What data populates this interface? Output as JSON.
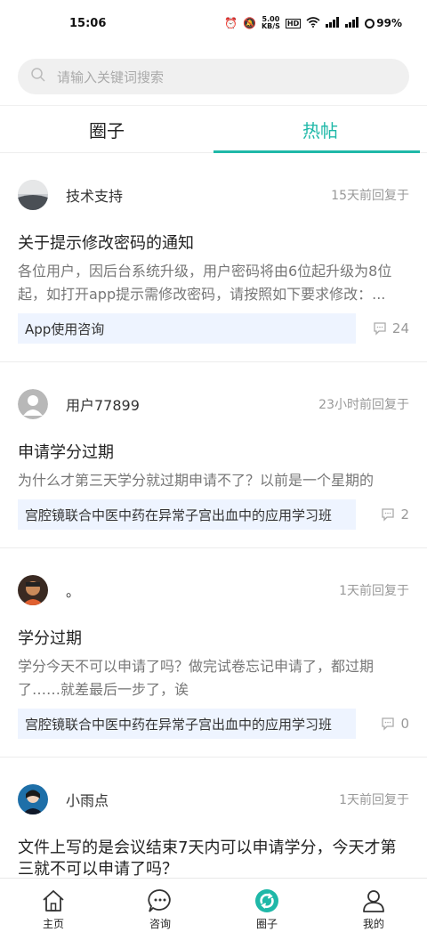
{
  "status_bar": {
    "time": "15:06",
    "net_speed": "5.00\nKB/S",
    "battery": "99%"
  },
  "search": {
    "placeholder": "请输入关键词搜索"
  },
  "tabs": [
    {
      "label": "圈子",
      "active": false
    },
    {
      "label": "热帖",
      "active": true
    }
  ],
  "posts": [
    {
      "author": "技术支持",
      "time": "15天前回复于",
      "title": "关于提示修改密码的通知",
      "body": "各位用户，因后台系统升级，用户密码将由6位起升级为8位起，如打开app提示需修改密码，请按照如下要求修改：...",
      "tag": "App使用咨询",
      "comments": "24"
    },
    {
      "author": "用户77899",
      "time": "23小时前回复于",
      "title": "申请学分过期",
      "body": "为什么才第三天学分就过期申请不了？以前是一个星期的",
      "tag": "宫腔镜联合中医中药在异常子宫出血中的应用学习班",
      "comments": "2"
    },
    {
      "author": "。",
      "time": "1天前回复于",
      "title": "学分过期",
      "body": "学分今天不可以申请了吗？做完试卷忘记申请了，都过期了……就差最后一步了，诶",
      "tag": "宫腔镜联合中医中药在异常子宫出血中的应用学习班",
      "comments": "0"
    },
    {
      "author": "小雨点",
      "time": "1天前回复于",
      "title": "文件上写的是会议结束7天内可以申请学分，今天才第三就不可以申请了吗？",
      "body": "",
      "tag": "",
      "comments": ""
    }
  ],
  "bottom_nav": [
    {
      "label": "主页",
      "icon": "home-icon"
    },
    {
      "label": "咨询",
      "icon": "chat-icon"
    },
    {
      "label": "圈子",
      "icon": "circle-icon",
      "active": true
    },
    {
      "label": "我的",
      "icon": "profile-icon"
    }
  ],
  "colors": {
    "accent": "#1fb8a8"
  }
}
